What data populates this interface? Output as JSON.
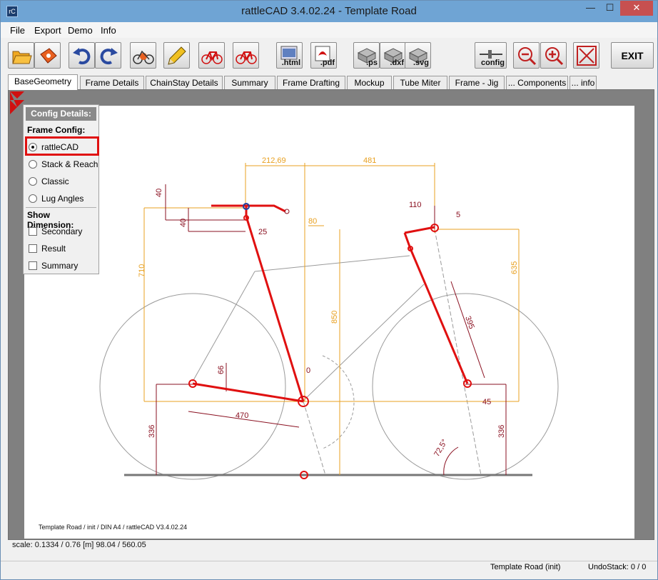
{
  "window": {
    "title": "rattleCAD  3.4.02.24 - Template Road",
    "app_icon": "rattlecad-logo-icon",
    "minimize_glyph": "—",
    "maximize_glyph": "☐",
    "close_glyph": "✕"
  },
  "menu": [
    "File",
    "Export",
    "Demo",
    "Info"
  ],
  "toolbar": {
    "buttons": [
      {
        "name": "open-folder",
        "label": ""
      },
      {
        "name": "save",
        "label": ""
      },
      {
        "name": "undo",
        "label": ""
      },
      {
        "name": "redo",
        "label": ""
      },
      {
        "name": "bike-settings",
        "label": ""
      },
      {
        "name": "edit",
        "label": ""
      },
      {
        "name": "bike-red-1",
        "label": ""
      },
      {
        "name": "bike-red-2",
        "label": ""
      },
      {
        "name": "export-html",
        "label": ".html"
      },
      {
        "name": "export-pdf",
        "label": ".pdf"
      },
      {
        "name": "export-ps",
        "label": ".ps"
      },
      {
        "name": "export-dxf",
        "label": ".dxf"
      },
      {
        "name": "export-svg",
        "label": ".svg"
      },
      {
        "name": "config",
        "label": "config"
      },
      {
        "name": "zoom-out",
        "label": ""
      },
      {
        "name": "zoom-in",
        "label": ""
      },
      {
        "name": "fit",
        "label": ""
      }
    ],
    "exit_label": "EXIT"
  },
  "tabs": [
    {
      "label": "BaseGeometry",
      "active": true
    },
    {
      "label": "Frame Details",
      "active": false
    },
    {
      "label": "ChainStay Details",
      "active": false
    },
    {
      "label": "Summary",
      "active": false
    },
    {
      "label": "Frame Drafting",
      "active": false
    },
    {
      "label": "Mockup",
      "active": false
    },
    {
      "label": "Tube Miter",
      "active": false
    },
    {
      "label": "Frame - Jig",
      "active": false
    },
    {
      "label": "... Components",
      "active": false
    },
    {
      "label": "... info",
      "active": false
    }
  ],
  "config_panel": {
    "title": "Config Details:",
    "frame_config_title": "Frame Config:",
    "frame_config_options": [
      {
        "label": "rattleCAD",
        "selected": true
      },
      {
        "label": "Stack & Reach",
        "selected": false
      },
      {
        "label": "Classic",
        "selected": false
      },
      {
        "label": "Lug Angles",
        "selected": false
      }
    ],
    "show_dimension_title": "Show Dimension:",
    "show_dimension_options": [
      {
        "label": "Secondary",
        "checked": false
      },
      {
        "label": "Result",
        "checked": false
      },
      {
        "label": "Summary",
        "checked": false
      }
    ]
  },
  "drawing": {
    "dimensions": [
      "212,69",
      "481",
      "40",
      "40",
      "25",
      "80",
      "110",
      "5",
      "710",
      "635",
      "850",
      "66",
      "0",
      "470",
      "336",
      "336",
      "45",
      "72,5°",
      "395"
    ],
    "footer_text": "Template Road   /   init   /  DIN A4  /   rattleCAD   V3.4.02.24"
  },
  "status": {
    "scale": "scale: 0.1334 / 0.76  [m]  98.04 / 560.05",
    "file": "Template Road (init)",
    "undo": "UndoStack:  0 / 0"
  },
  "colors": {
    "accent_red": "#e01010",
    "dimension_orange": "#e8a020",
    "dimension_darkred": "#8a1020",
    "titlebar": "#6fa4d4"
  }
}
